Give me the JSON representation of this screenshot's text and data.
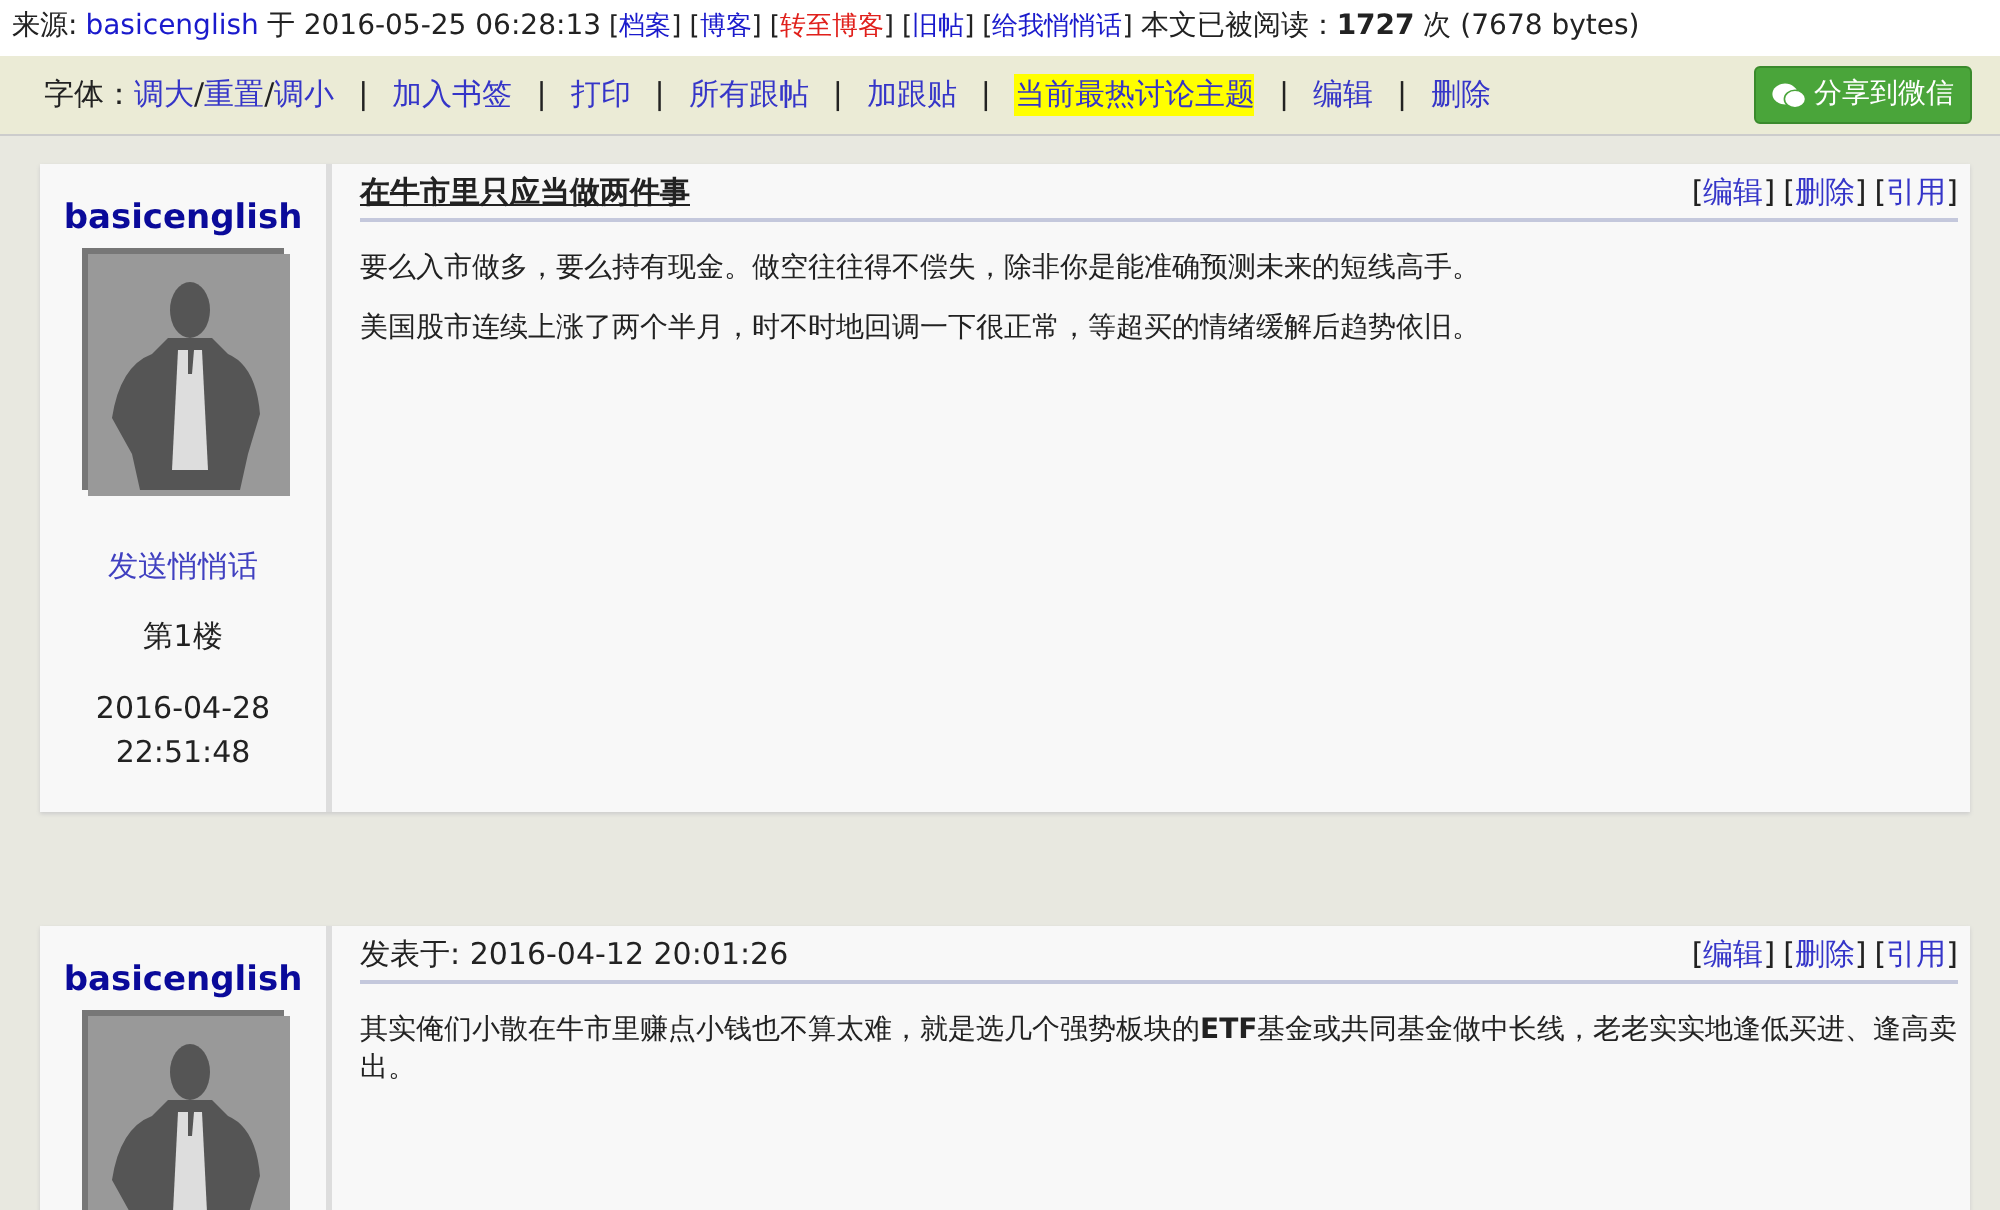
{
  "header": {
    "source_label": "来源:",
    "author": "basicenglish",
    "time_prefix": "于",
    "time": "2016-05-25 06:28:13",
    "bracket_open": "[",
    "bracket_close": "]",
    "links": [
      {
        "label": "档案",
        "kind": "normal"
      },
      {
        "label": "博客",
        "kind": "normal"
      },
      {
        "label": "转至博客",
        "kind": "red"
      },
      {
        "label": "旧帖",
        "kind": "normal"
      },
      {
        "label": "给我悄悄话",
        "kind": "normal"
      }
    ],
    "read_text": "本文已被阅读：**1727** 次 (7678 bytes)"
  },
  "toolbar": {
    "font_label": "字体：",
    "font_links": [
      "调大",
      "重置",
      "调小"
    ],
    "font_separator": "/",
    "separator": "|",
    "links": [
      {
        "label": "加入书签",
        "highlighted": false
      },
      {
        "label": "打印",
        "highlighted": false
      },
      {
        "label": "所有跟帖",
        "highlighted": false
      },
      {
        "label": "加跟贴",
        "highlighted": false
      },
      {
        "label": "当前最热讨论主题",
        "highlighted": true
      },
      {
        "label": "编辑",
        "highlighted": false
      },
      {
        "label": "删除",
        "highlighted": false
      }
    ],
    "share_button": "分享到微信"
  },
  "posts": [
    {
      "kind": "title",
      "author": "basicenglish",
      "heading": "在牛市里只应当做两件事",
      "send_message": "发送悄悄话",
      "floor": "第1楼",
      "date": "2016-04-28",
      "time": "22:51:48",
      "actions": [
        "编辑",
        "删除",
        "引用"
      ],
      "paragraphs": [
        "要么入市做多，要么持有现金。做空往往得不偿失，除非你是能准确预测未来的短线高手。",
        "美国股市连续上涨了两个半月，时不时地回调一下很正常，等超买的情绪缓解后趋势依旧。"
      ]
    },
    {
      "kind": "posted",
      "author": "basicenglish",
      "heading": "发表于: 2016-04-12 20:01:26",
      "actions": [
        "编辑",
        "删除",
        "引用"
      ],
      "paragraphs": [
        "其实俺们小散在牛市里赚点小钱也不算太难，就是选几个强势板块的**ETF**基金或共同基金做中长线，老老实实地逢低买进、逢高卖出。"
      ]
    }
  ]
}
